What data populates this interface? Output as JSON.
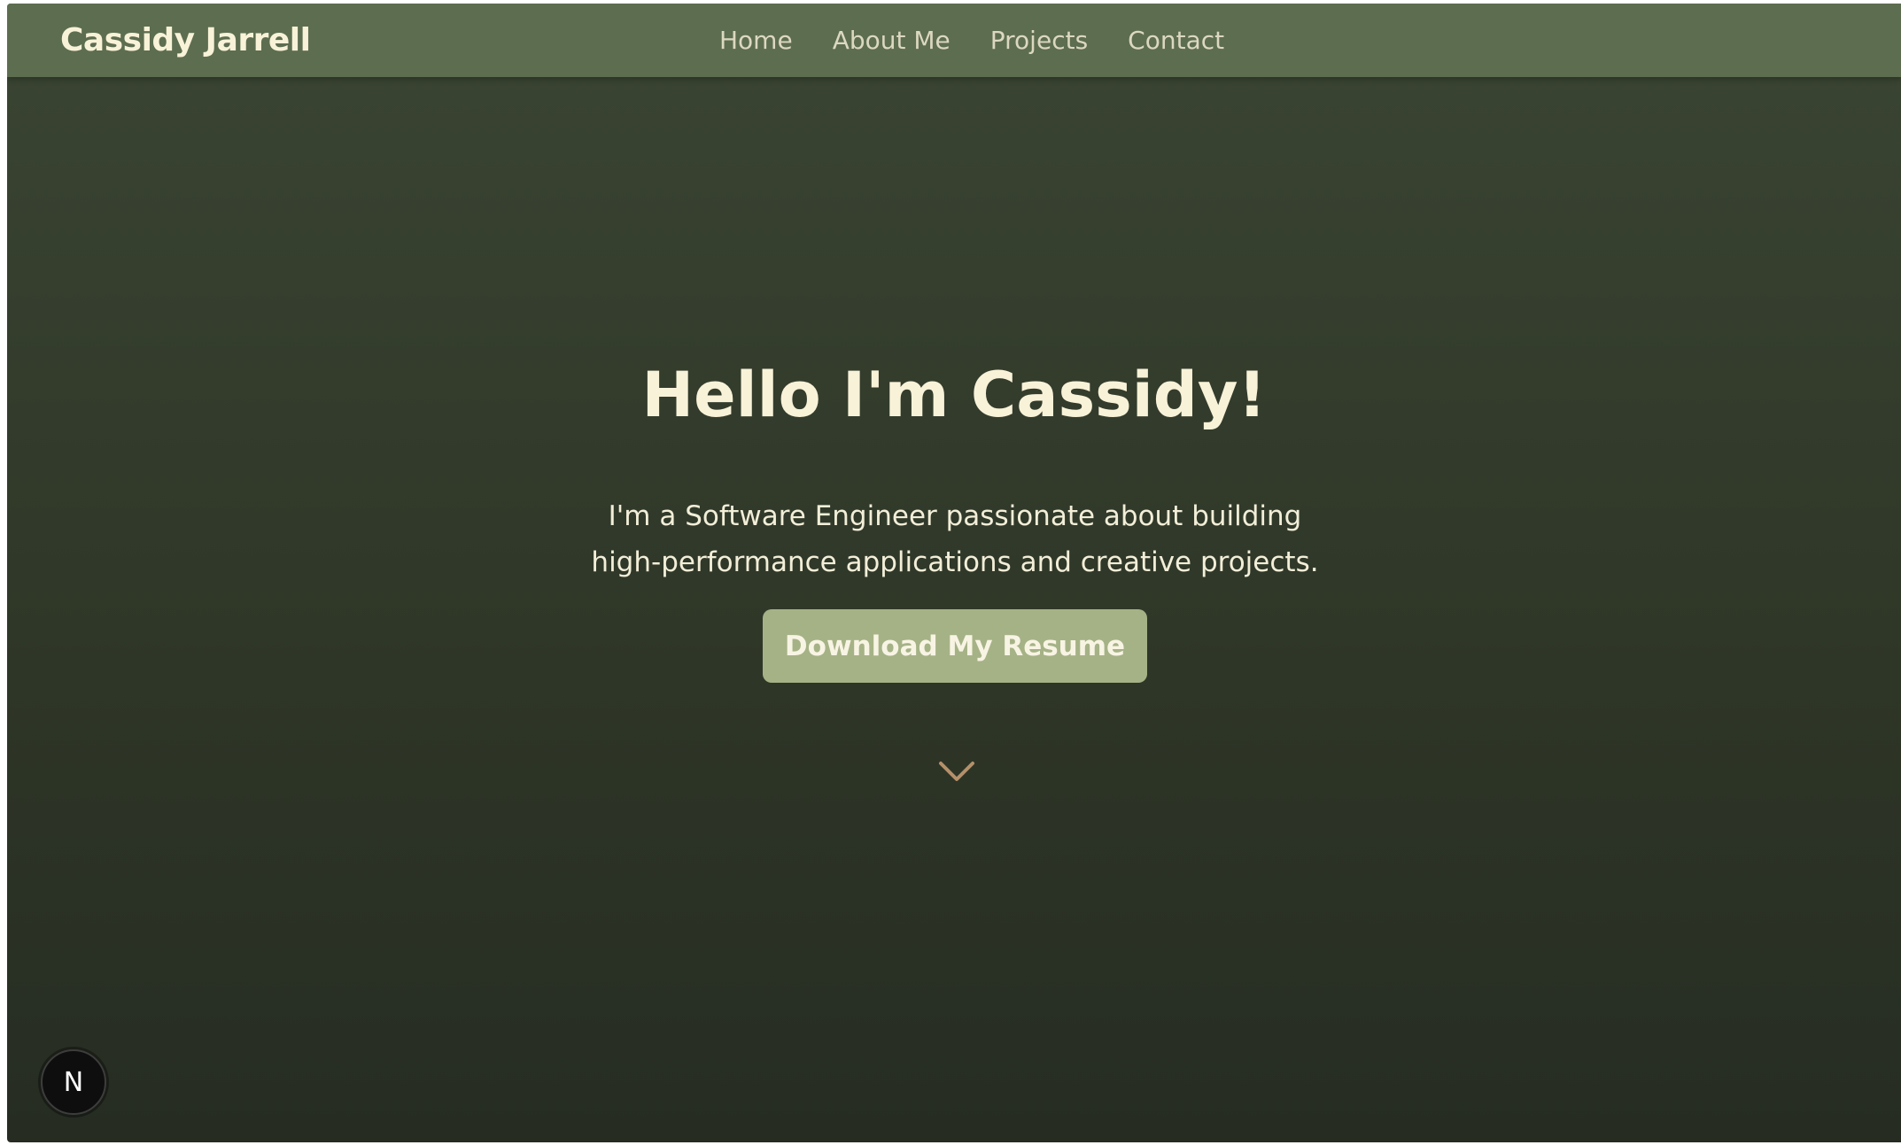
{
  "navbar": {
    "brand": "Cassidy Jarrell",
    "links": [
      {
        "label": "Home"
      },
      {
        "label": "About Me"
      },
      {
        "label": "Projects"
      },
      {
        "label": "Contact"
      }
    ]
  },
  "hero": {
    "title": "Hello I'm Cassidy!",
    "subtitle": "I'm a Software Engineer passionate about building high-performance applications and creative projects.",
    "button_label": "Download My Resume",
    "scroll_icon": "chevron-down-icon"
  },
  "dev_badge": {
    "letter": "N"
  },
  "colors": {
    "navbar_bg": "#5d6d50",
    "hero_bg_top": "#3b4533",
    "hero_bg_bottom": "#262c22",
    "accent_button": "#a5b286",
    "heading_text": "#f8f2d8",
    "chevron": "#b4906a"
  }
}
